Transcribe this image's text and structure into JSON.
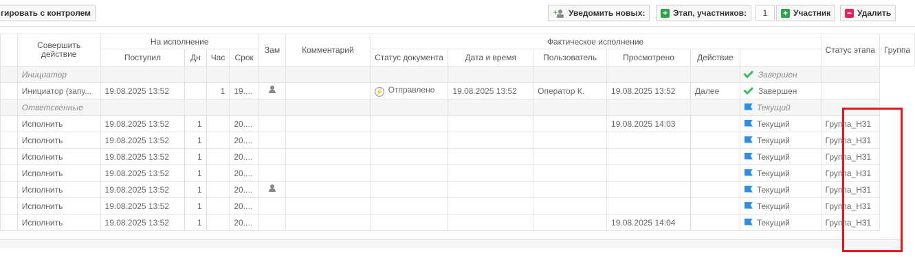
{
  "toolbar": {
    "left_button": "гировать с контролем",
    "notify_new": "Уведомить новых:",
    "stage_participants": "Этап, участников:",
    "participants_count": "1",
    "add_participant": "Участник",
    "delete": "Удалить"
  },
  "headers": {
    "group_execution": "На исполнение",
    "group_actual": "Фактическое исполнение",
    "perform_action": "Совершить действие",
    "received": "Поступил",
    "days": "Дн",
    "hours": "Час",
    "deadline": "Срок",
    "deputy": "Зам",
    "comment": "Комментарий",
    "doc_status": "Статус документа",
    "datetime": "Дата и время",
    "user": "Пользователь",
    "viewed": "Просмотрено",
    "action": "Действие",
    "stage_status": "Статус этапа",
    "group": "Группа"
  },
  "rows": [
    {
      "kind": "group",
      "action": "Инициатор",
      "stage_status": "Завершен",
      "stage_icon": "check-icon"
    },
    {
      "kind": "data",
      "action": "Инициатор (запу...",
      "received": "19.08.2025 13:52",
      "days": "",
      "hours": "1",
      "deadline": "19....",
      "deputy_icon": true,
      "doc_status": "Отправлено",
      "datetime": "19.08.2025 13:52",
      "user": "Оператор К.",
      "viewed": "19.08.2025 13:52",
      "act": "Далее",
      "stage_status": "Завершен",
      "stage_icon": "check-icon",
      "group": ""
    },
    {
      "kind": "group",
      "action": "Ответсвенные",
      "stage_status": "Текущий",
      "stage_icon": "flag-icon"
    },
    {
      "kind": "data",
      "action": "Исполнить",
      "received": "19.08.2025 13:52",
      "days": "1",
      "hours": "",
      "deadline": "20....",
      "deputy_icon": false,
      "doc_status": "",
      "datetime": "",
      "user": "",
      "viewed": "19.08.2025 14:03",
      "act": "",
      "stage_status": "Текущий",
      "stage_icon": "flag-icon",
      "group": "Группа_Н31"
    },
    {
      "kind": "data",
      "action": "Исполнить",
      "received": "19.08.2025 13:52",
      "days": "1",
      "hours": "",
      "deadline": "20....",
      "deputy_icon": false,
      "doc_status": "",
      "datetime": "",
      "user": "",
      "viewed": "",
      "act": "",
      "stage_status": "Текущий",
      "stage_icon": "flag-icon",
      "group": "Группа_Н31"
    },
    {
      "kind": "data",
      "action": "Исполнить",
      "received": "19.08.2025 13:52",
      "days": "1",
      "hours": "",
      "deadline": "20....",
      "deputy_icon": false,
      "doc_status": "",
      "datetime": "",
      "user": "",
      "viewed": "",
      "act": "",
      "stage_status": "Текущий",
      "stage_icon": "flag-icon",
      "group": "Группа_Н31"
    },
    {
      "kind": "data",
      "action": "Исполнить",
      "received": "19.08.2025 13:52",
      "days": "1",
      "hours": "",
      "deadline": "20....",
      "deputy_icon": false,
      "doc_status": "",
      "datetime": "",
      "user": "",
      "viewed": "",
      "act": "",
      "stage_status": "Текущий",
      "stage_icon": "flag-icon",
      "group": "Группа_Н31"
    },
    {
      "kind": "data",
      "action": "Исполнить",
      "received": "19.08.2025 13:52",
      "days": "1",
      "hours": "",
      "deadline": "20....",
      "deputy_icon": true,
      "doc_status": "",
      "datetime": "",
      "user": "",
      "viewed": "",
      "act": "",
      "stage_status": "Текущий",
      "stage_icon": "flag-icon",
      "group": "Группа_Н31"
    },
    {
      "kind": "data",
      "action": "Исполнить",
      "received": "19.08.2025 13:52",
      "days": "1",
      "hours": "",
      "deadline": "20....",
      "deputy_icon": false,
      "doc_status": "",
      "datetime": "",
      "user": "",
      "viewed": "",
      "act": "",
      "stage_status": "Текущий",
      "stage_icon": "flag-icon",
      "group": "Группа_Н31"
    },
    {
      "kind": "data",
      "action": "Исполнить",
      "received": "19.08.2025 13:52",
      "days": "1",
      "hours": "",
      "deadline": "20....",
      "deputy_icon": false,
      "doc_status": "",
      "datetime": "",
      "user": "",
      "viewed": "19.08.2025 14:04",
      "act": "",
      "stage_status": "Текущий",
      "stage_icon": "flag-icon",
      "group": "Группа_Н31"
    }
  ],
  "colors": {
    "highlight_box": "#e3161b",
    "complete_check": "#3fb95e",
    "current_flag": "#2b8ee3",
    "green_button_icon": "#2ea44f",
    "delete_icon": "#e0245e"
  }
}
